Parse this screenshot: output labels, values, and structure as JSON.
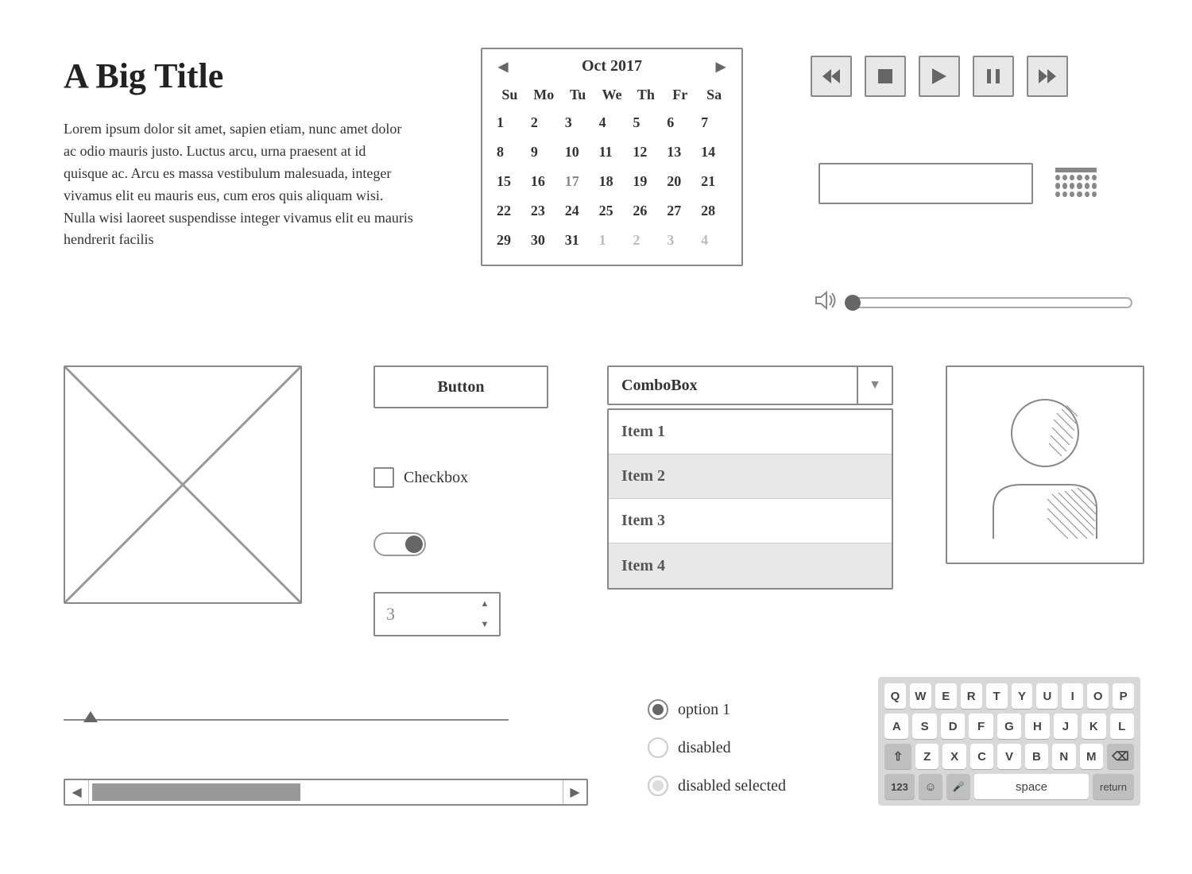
{
  "title": "A Big Title",
  "paragraph": "Lorem ipsum dolor sit amet, sapien etiam, nunc amet dolor ac odio mauris justo. Luctus arcu, urna praesent at id quisque ac. Arcu es massa vestibulum malesuada, integer vivamus elit eu mauris eus, cum eros quis aliquam wisi. Nulla wisi laoreet suspendisse integer vivamus elit eu mauris hendrerit facilis",
  "calendar": {
    "month_label": "Oct  2017",
    "dow": [
      "Su",
      "Mo",
      "Tu",
      "We",
      "Th",
      "Fr",
      "Sa"
    ],
    "days": [
      {
        "n": "1"
      },
      {
        "n": "2"
      },
      {
        "n": "3"
      },
      {
        "n": "4"
      },
      {
        "n": "5"
      },
      {
        "n": "6"
      },
      {
        "n": "7"
      },
      {
        "n": "8"
      },
      {
        "n": "9"
      },
      {
        "n": "10"
      },
      {
        "n": "11"
      },
      {
        "n": "12"
      },
      {
        "n": "13"
      },
      {
        "n": "14"
      },
      {
        "n": "15"
      },
      {
        "n": "16"
      },
      {
        "n": "17",
        "today": true
      },
      {
        "n": "18"
      },
      {
        "n": "19"
      },
      {
        "n": "20"
      },
      {
        "n": "21"
      },
      {
        "n": "22"
      },
      {
        "n": "23"
      },
      {
        "n": "24"
      },
      {
        "n": "25"
      },
      {
        "n": "26"
      },
      {
        "n": "27"
      },
      {
        "n": "28"
      },
      {
        "n": "29"
      },
      {
        "n": "30"
      },
      {
        "n": "31"
      },
      {
        "n": "1",
        "muted": true
      },
      {
        "n": "2",
        "muted": true
      },
      {
        "n": "3",
        "muted": true
      },
      {
        "n": "4",
        "muted": true
      }
    ]
  },
  "button_label": "Button",
  "checkbox_label": "Checkbox",
  "stepper_value": "3",
  "combo_label": "ComboBox",
  "list_items": [
    "Item 1",
    "Item 2",
    "Item 3",
    "Item 4"
  ],
  "radios": [
    {
      "label": "option 1",
      "selected": true,
      "disabled": false
    },
    {
      "label": "disabled",
      "selected": false,
      "disabled": true
    },
    {
      "label": "disabled selected",
      "selected": true,
      "disabled": true
    }
  ],
  "keyboard": {
    "row1": [
      "Q",
      "W",
      "E",
      "R",
      "T",
      "Y",
      "U",
      "I",
      "O",
      "P"
    ],
    "row2": [
      "A",
      "S",
      "D",
      "F",
      "G",
      "H",
      "J",
      "K",
      "L"
    ],
    "row3": [
      "Z",
      "X",
      "C",
      "V",
      "B",
      "N",
      "M"
    ],
    "numkey": "123",
    "spacekey": "space",
    "returnkey": "return"
  }
}
